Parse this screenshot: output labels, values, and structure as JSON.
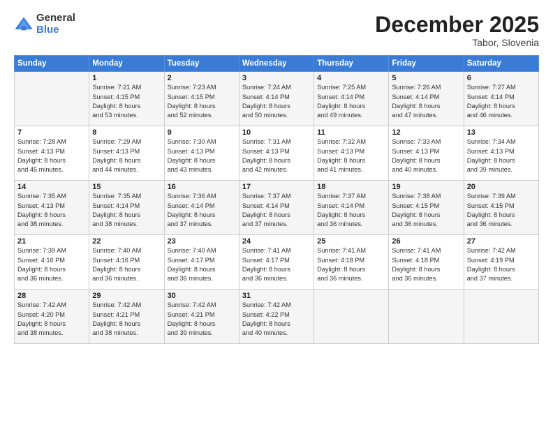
{
  "logo": {
    "general": "General",
    "blue": "Blue"
  },
  "header": {
    "month": "December 2025",
    "location": "Tabor, Slovenia"
  },
  "weekdays": [
    "Sunday",
    "Monday",
    "Tuesday",
    "Wednesday",
    "Thursday",
    "Friday",
    "Saturday"
  ],
  "weeks": [
    [
      {
        "day": "",
        "info": ""
      },
      {
        "day": "1",
        "info": "Sunrise: 7:21 AM\nSunset: 4:15 PM\nDaylight: 8 hours\nand 53 minutes."
      },
      {
        "day": "2",
        "info": "Sunrise: 7:23 AM\nSunset: 4:15 PM\nDaylight: 8 hours\nand 52 minutes."
      },
      {
        "day": "3",
        "info": "Sunrise: 7:24 AM\nSunset: 4:14 PM\nDaylight: 8 hours\nand 50 minutes."
      },
      {
        "day": "4",
        "info": "Sunrise: 7:25 AM\nSunset: 4:14 PM\nDaylight: 8 hours\nand 49 minutes."
      },
      {
        "day": "5",
        "info": "Sunrise: 7:26 AM\nSunset: 4:14 PM\nDaylight: 8 hours\nand 47 minutes."
      },
      {
        "day": "6",
        "info": "Sunrise: 7:27 AM\nSunset: 4:14 PM\nDaylight: 8 hours\nand 46 minutes."
      }
    ],
    [
      {
        "day": "7",
        "info": "Sunrise: 7:28 AM\nSunset: 4:13 PM\nDaylight: 8 hours\nand 45 minutes."
      },
      {
        "day": "8",
        "info": "Sunrise: 7:29 AM\nSunset: 4:13 PM\nDaylight: 8 hours\nand 44 minutes."
      },
      {
        "day": "9",
        "info": "Sunrise: 7:30 AM\nSunset: 4:13 PM\nDaylight: 8 hours\nand 43 minutes."
      },
      {
        "day": "10",
        "info": "Sunrise: 7:31 AM\nSunset: 4:13 PM\nDaylight: 8 hours\nand 42 minutes."
      },
      {
        "day": "11",
        "info": "Sunrise: 7:32 AM\nSunset: 4:13 PM\nDaylight: 8 hours\nand 41 minutes."
      },
      {
        "day": "12",
        "info": "Sunrise: 7:33 AM\nSunset: 4:13 PM\nDaylight: 8 hours\nand 40 minutes."
      },
      {
        "day": "13",
        "info": "Sunrise: 7:34 AM\nSunset: 4:13 PM\nDaylight: 8 hours\nand 39 minutes."
      }
    ],
    [
      {
        "day": "14",
        "info": "Sunrise: 7:35 AM\nSunset: 4:13 PM\nDaylight: 8 hours\nand 38 minutes."
      },
      {
        "day": "15",
        "info": "Sunrise: 7:35 AM\nSunset: 4:14 PM\nDaylight: 8 hours\nand 38 minutes."
      },
      {
        "day": "16",
        "info": "Sunrise: 7:36 AM\nSunset: 4:14 PM\nDaylight: 8 hours\nand 37 minutes."
      },
      {
        "day": "17",
        "info": "Sunrise: 7:37 AM\nSunset: 4:14 PM\nDaylight: 8 hours\nand 37 minutes."
      },
      {
        "day": "18",
        "info": "Sunrise: 7:37 AM\nSunset: 4:14 PM\nDaylight: 8 hours\nand 36 minutes."
      },
      {
        "day": "19",
        "info": "Sunrise: 7:38 AM\nSunset: 4:15 PM\nDaylight: 8 hours\nand 36 minutes."
      },
      {
        "day": "20",
        "info": "Sunrise: 7:39 AM\nSunset: 4:15 PM\nDaylight: 8 hours\nand 36 minutes."
      }
    ],
    [
      {
        "day": "21",
        "info": "Sunrise: 7:39 AM\nSunset: 4:16 PM\nDaylight: 8 hours\nand 36 minutes."
      },
      {
        "day": "22",
        "info": "Sunrise: 7:40 AM\nSunset: 4:16 PM\nDaylight: 8 hours\nand 36 minutes."
      },
      {
        "day": "23",
        "info": "Sunrise: 7:40 AM\nSunset: 4:17 PM\nDaylight: 8 hours\nand 36 minutes."
      },
      {
        "day": "24",
        "info": "Sunrise: 7:41 AM\nSunset: 4:17 PM\nDaylight: 8 hours\nand 36 minutes."
      },
      {
        "day": "25",
        "info": "Sunrise: 7:41 AM\nSunset: 4:18 PM\nDaylight: 8 hours\nand 36 minutes."
      },
      {
        "day": "26",
        "info": "Sunrise: 7:41 AM\nSunset: 4:18 PM\nDaylight: 8 hours\nand 36 minutes."
      },
      {
        "day": "27",
        "info": "Sunrise: 7:42 AM\nSunset: 4:19 PM\nDaylight: 8 hours\nand 37 minutes."
      }
    ],
    [
      {
        "day": "28",
        "info": "Sunrise: 7:42 AM\nSunset: 4:20 PM\nDaylight: 8 hours\nand 38 minutes."
      },
      {
        "day": "29",
        "info": "Sunrise: 7:42 AM\nSunset: 4:21 PM\nDaylight: 8 hours\nand 38 minutes."
      },
      {
        "day": "30",
        "info": "Sunrise: 7:42 AM\nSunset: 4:21 PM\nDaylight: 8 hours\nand 39 minutes."
      },
      {
        "day": "31",
        "info": "Sunrise: 7:42 AM\nSunset: 4:22 PM\nDaylight: 8 hours\nand 40 minutes."
      },
      {
        "day": "",
        "info": ""
      },
      {
        "day": "",
        "info": ""
      },
      {
        "day": "",
        "info": ""
      }
    ]
  ]
}
